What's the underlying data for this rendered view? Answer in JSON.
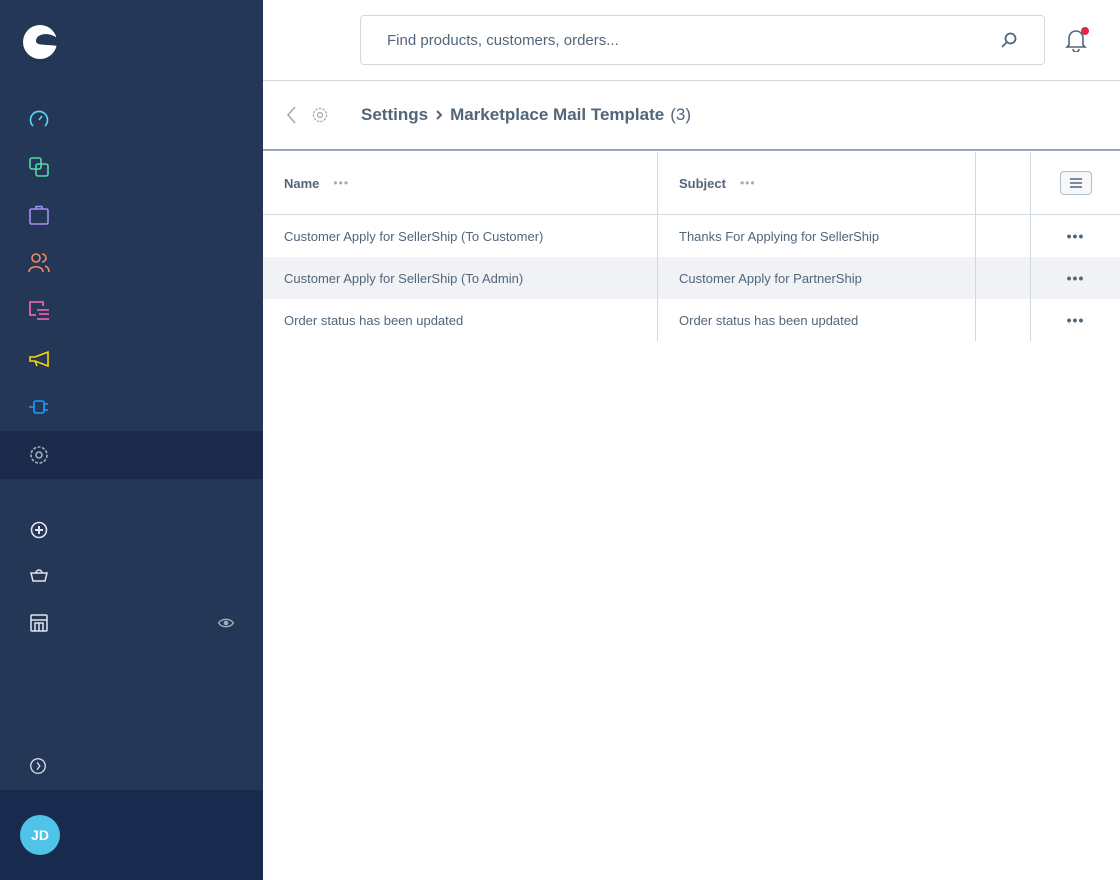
{
  "sidebar": {
    "items": [
      {
        "icon": "dashboard-icon",
        "color": "#57d9f6"
      },
      {
        "icon": "catalogue-icon",
        "color": "#57d9a3"
      },
      {
        "icon": "orders-icon",
        "color": "#a092f0"
      },
      {
        "icon": "customers-icon",
        "color": "#f88962"
      },
      {
        "icon": "content-icon",
        "color": "#ff68b4"
      },
      {
        "icon": "marketing-icon",
        "color": "#ffd700"
      },
      {
        "icon": "extensions-icon",
        "color": "#189eff"
      },
      {
        "icon": "settings-icon",
        "color": "#a0acb8",
        "active": true
      }
    ],
    "secondary": [
      "add-sales-channel-icon",
      "headless-icon",
      "storefront-icon"
    ],
    "user_initials": "JD"
  },
  "search": {
    "placeholder": "Find products, customers, orders..."
  },
  "breadcrumb": {
    "parent": "Settings",
    "current": "Marketplace Mail Template",
    "count": "(3)"
  },
  "table": {
    "columns": [
      "Name",
      "Subject"
    ],
    "rows": [
      {
        "name": "Customer Apply for SellerShip (To Customer)",
        "subject": "Thanks For Applying for SellerShip"
      },
      {
        "name": "Customer Apply for SellerShip (To Admin)",
        "subject": "Customer Apply for PartnerShip"
      },
      {
        "name": "Order status has been updated",
        "subject": "Order status has been updated"
      }
    ]
  },
  "colors": {
    "sidebar": "#243757",
    "notification": "#de294c",
    "avatar": "#4fc3e8"
  }
}
